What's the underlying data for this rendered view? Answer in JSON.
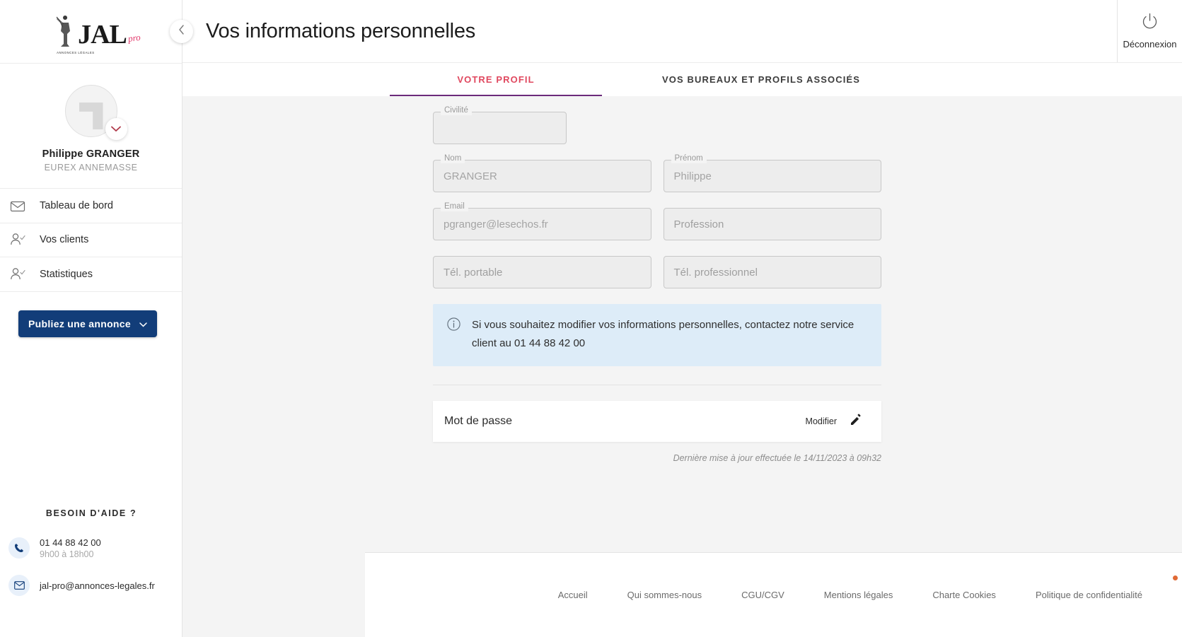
{
  "brand": {
    "wordmark": "JAL",
    "suffix": "pro",
    "tagline": "ANNONCES LÉGALES"
  },
  "sidebar": {
    "profile": {
      "name": "Philippe GRANGER",
      "org": "EUREX ANNEMASSE",
      "avatar_icon": "user-silhouette-icon",
      "caret_icon": "chevron-down-icon"
    },
    "nav": [
      {
        "label": "Tableau de bord",
        "icon": "briefcase-icon"
      },
      {
        "label": "Vos clients",
        "icon": "user-check-icon"
      },
      {
        "label": "Statistiques",
        "icon": "user-check-icon"
      }
    ],
    "publish_button": {
      "label": "Publiez une annonce",
      "icon": "chevron-down-icon"
    },
    "help": {
      "title": "BESOIN D'AIDE ?",
      "phone": "01 44 88 42 00",
      "hours": "9h00 à 18h00",
      "email": "jal-pro@annonces-legales.fr",
      "phone_icon": "phone-icon",
      "mail_icon": "envelope-icon"
    }
  },
  "topbar": {
    "back_icon": "chevron-left-icon",
    "title": "Vos informations personnelles",
    "logout": {
      "label": "Déconnexion",
      "icon": "power-icon"
    }
  },
  "tabs": [
    {
      "label": "VOTRE PROFIL",
      "active": true
    },
    {
      "label": "VOS BUREAUX ET PROFILS ASSOCIÉS",
      "active": false
    }
  ],
  "form": {
    "civilite": {
      "label": "Civilité",
      "value": ""
    },
    "nom": {
      "label": "Nom",
      "value": "GRANGER"
    },
    "prenom": {
      "label": "Prénom",
      "value": "Philippe"
    },
    "email": {
      "label": "Email",
      "value": "pgranger@lesechos.fr"
    },
    "profession": {
      "label": "",
      "placeholder": "Profession"
    },
    "tel_portable": {
      "label": "",
      "placeholder": "Tél. portable"
    },
    "tel_professionnel": {
      "label": "",
      "placeholder": "Tél. professionnel"
    }
  },
  "alert": {
    "icon": "info-icon",
    "text": "Si vous souhaitez modifier vos informations personnelles, contactez notre service client au 01 44 88 42 00"
  },
  "password": {
    "label": "Mot de passe",
    "action_label": "Modifier",
    "action_icon": "pencil-icon"
  },
  "last_update": "Dernière mise à jour effectuée le 14/11/2023 à 09h32",
  "footer": {
    "links": [
      "Accueil",
      "Qui sommes-nous",
      "CGU/CGV",
      "Mentions légales",
      "Charte Cookies",
      "Politique de confidentialité"
    ]
  },
  "colors": {
    "accent_red": "#e0485f",
    "tab_underline": "#6b2a7a",
    "publish_blue": "#123d79",
    "alert_bg": "#ddecf8"
  }
}
